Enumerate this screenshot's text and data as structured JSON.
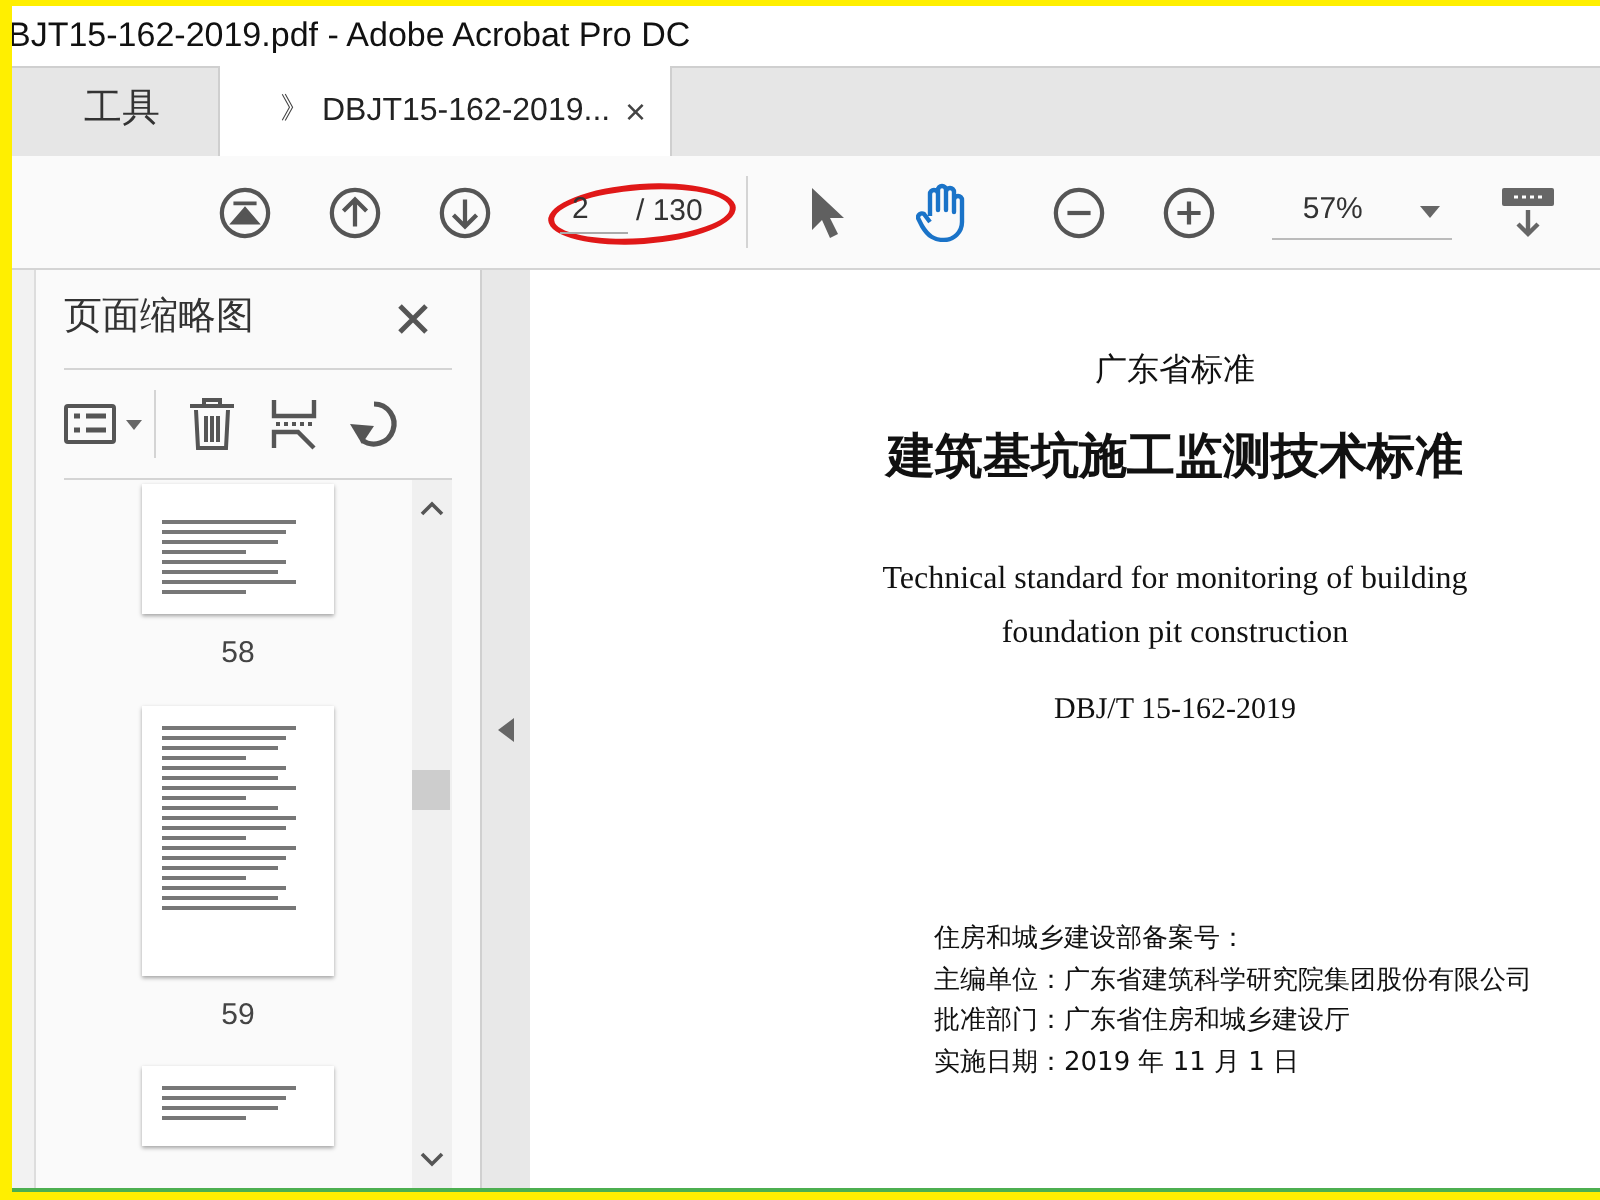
{
  "window": {
    "title": "BJT15-162-2019.pdf - Adobe Acrobat Pro DC"
  },
  "tabs": [
    {
      "label": "工具",
      "selected": false
    },
    {
      "icon": "》",
      "label": "DBJT15-162-2019...",
      "selected": true,
      "close": "×"
    }
  ],
  "toolbar": {
    "page_field": {
      "value": "2",
      "total": "/ 130"
    },
    "highlight_annotation": true,
    "hand_tool_selected": true,
    "zoom": "57%"
  },
  "thumbnails_panel": {
    "title": "页面缩略图",
    "thumbnails": [
      {
        "page": "58",
        "cut_off": true
      },
      {
        "page": "59",
        "cut_off": false
      },
      {
        "cut_off": true
      }
    ]
  },
  "document": {
    "lines": [
      {
        "kind": "subtitle",
        "text": "广东省标准"
      },
      {
        "kind": "title",
        "text": "建筑基坑施工监测技术标准"
      },
      {
        "kind": "english",
        "text": "Technical standard for monitoring of building"
      },
      {
        "kind": "english",
        "text": "foundation pit construction"
      },
      {
        "kind": "code",
        "text": "DBJ/T 15-162-2019"
      }
    ],
    "info": [
      "住房和城乡建设部备案号：",
      "主编单位：广东省建筑科学研究院集团股份有限公司",
      "批准部门：广东省住房和城乡建设厅",
      "实施日期：2019 年 11 月 1 日"
    ]
  }
}
